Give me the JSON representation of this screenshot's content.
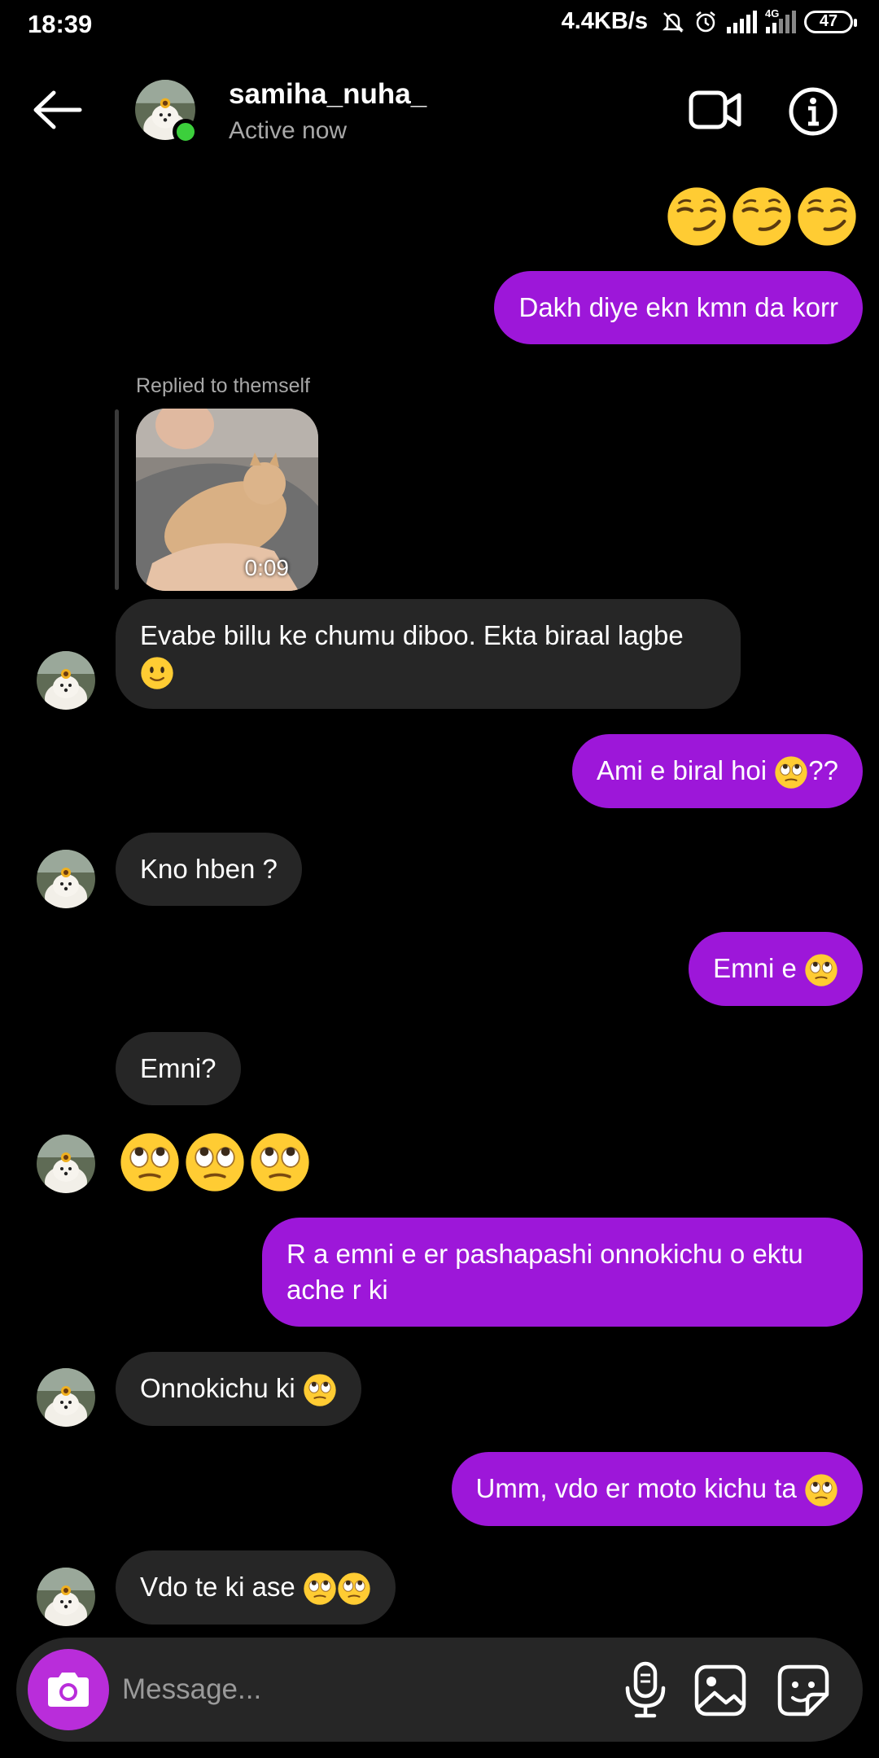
{
  "status_bar": {
    "time": "18:39",
    "net_speed": "4.4KB/s",
    "network_label": "4G",
    "battery": "47"
  },
  "header": {
    "contact_name": "samiha_nuha_",
    "contact_status": "Active now",
    "icons": [
      "back-arrow-icon",
      "video-call-icon",
      "info-icon"
    ]
  },
  "conversation": {
    "reply_label": "Replied to themself",
    "video_duration": "0:09",
    "messages": [
      {
        "from": "me",
        "text": "😏😏😏",
        "emoji_only": true
      },
      {
        "from": "me",
        "text": "Dakh diye ekn kmn da korr"
      },
      {
        "from": "them",
        "text": "Evabe billu ke chumu diboo. Ekta biraal lagbe",
        "emoji": "🙂"
      },
      {
        "from": "me",
        "text": "Ami e biral hoi ",
        "emoji": "🙄",
        "suffix": "??"
      },
      {
        "from": "them",
        "text": "Kno hben ?"
      },
      {
        "from": "me",
        "text": "Emni e ",
        "emoji": "🙄"
      },
      {
        "from": "them",
        "text": "Emni?"
      },
      {
        "from": "them",
        "text": "🙄🙄🙄",
        "emoji_only": true
      },
      {
        "from": "me",
        "line1": "R a emni e er pashapashi onnokichu o ektu",
        "line2": "ache r ki"
      },
      {
        "from": "them",
        "text": "Onnokichu ki ",
        "emoji": "🙄"
      },
      {
        "from": "me",
        "text": "Umm, vdo er moto kichu ta ",
        "emoji": "🙄"
      },
      {
        "from": "them",
        "text": "Vdo te ki ase ",
        "emoji": "🙄🙄"
      }
    ]
  },
  "composer": {
    "placeholder": "Message...",
    "icons": [
      "camera-icon",
      "microphone-icon",
      "gallery-icon",
      "sticker-icon"
    ]
  },
  "colors": {
    "background": "#000000",
    "sent_bubble": "#9d17d9",
    "received_bubble": "#262626",
    "camera_button": "#b92dda",
    "online_dot": "#3ccf3c",
    "secondary_text": "#a8a8a8"
  }
}
